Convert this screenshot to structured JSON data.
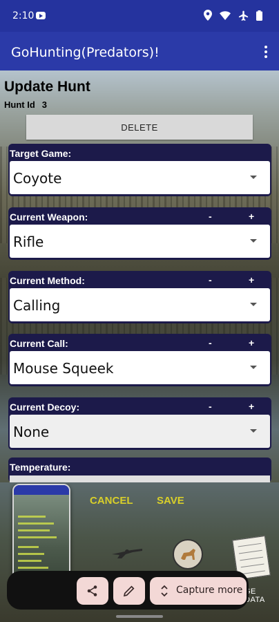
{
  "status_bar": {
    "time": "2:10"
  },
  "app_bar": {
    "title": "GoHunting(Predators)!"
  },
  "page": {
    "title": "Update Hunt",
    "hunt_id_label": "Hunt Id",
    "hunt_id_value": "3",
    "delete_label": "DELETE"
  },
  "fields": {
    "target_game": {
      "label": "Target Game:",
      "value": "Coyote"
    },
    "weapon": {
      "label": "Current Weapon:",
      "value": "Rifle",
      "minus": "-",
      "plus": "+"
    },
    "method": {
      "label": "Current Method:",
      "value": "Calling",
      "minus": "-",
      "plus": "+"
    },
    "call": {
      "label": "Current Call:",
      "value": "Mouse Squeek",
      "minus": "-",
      "plus": "+"
    },
    "decoy": {
      "label": "Current Decoy:",
      "value": "None",
      "minus": "-",
      "plus": "+"
    },
    "temperature": {
      "label": "Temperature:"
    }
  },
  "bottom": {
    "cancel_label": "CANCEL",
    "save_label": "SAVE",
    "partial_label": "GE DATA"
  },
  "screenshot_actions": {
    "capture_more_label": "Capture more"
  },
  "icons": {
    "status": [
      "location-icon",
      "wifi-icon",
      "airplane-icon",
      "battery-icon"
    ],
    "actions": [
      "share-icon",
      "edit-icon",
      "expand-icon"
    ]
  },
  "colors": {
    "app_bar": "#2b3aa8",
    "field_header": "#1c1a4a",
    "bottom_labels": "#d8cf2a",
    "action_button": "#f3d8d6"
  }
}
